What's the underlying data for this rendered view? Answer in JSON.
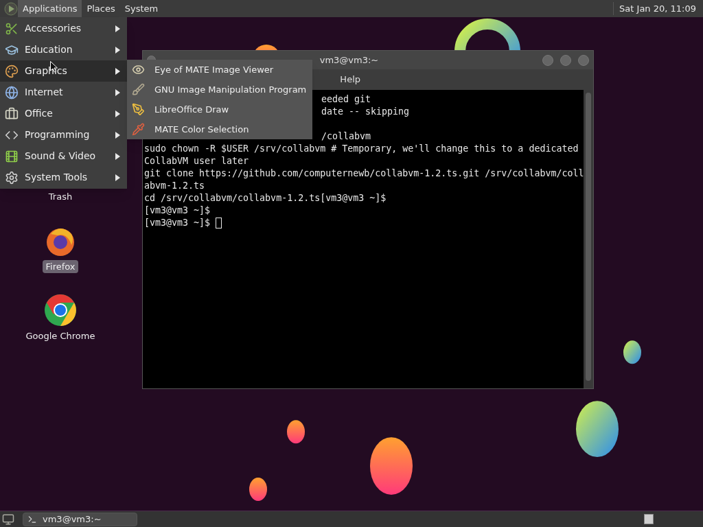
{
  "top_panel": {
    "menus": [
      {
        "label": "Applications",
        "selected": true
      },
      {
        "label": "Places",
        "selected": false
      },
      {
        "label": "System",
        "selected": false
      }
    ],
    "clock": "Sat Jan 20, 11:09"
  },
  "applications_menu": {
    "items": [
      {
        "label": "Accessories",
        "selected": false
      },
      {
        "label": "Education",
        "selected": false
      },
      {
        "label": "Graphics",
        "selected": true
      },
      {
        "label": "Internet",
        "selected": false
      },
      {
        "label": "Office",
        "selected": false
      },
      {
        "label": "Programming",
        "selected": false
      },
      {
        "label": "Sound & Video",
        "selected": false
      },
      {
        "label": "System Tools",
        "selected": false
      }
    ]
  },
  "graphics_submenu": {
    "items": [
      {
        "label": "Eye of MATE Image Viewer"
      },
      {
        "label": "GNU Image Manipulation Program"
      },
      {
        "label": "LibreOffice Draw"
      },
      {
        "label": "MATE Color Selection"
      }
    ]
  },
  "desktop_icons": [
    {
      "label": "Trash",
      "selected": false,
      "kind": "trash"
    },
    {
      "label": "Firefox",
      "selected": true,
      "kind": "firefox"
    },
    {
      "label": "Google Chrome",
      "selected": false,
      "kind": "chrome"
    }
  ],
  "terminal": {
    "title": "vm3@vm3:~",
    "menu": [
      "Help"
    ],
    "lines": [
      {
        "kind": "partial",
        "text": "eeded git"
      },
      {
        "kind": "partial",
        "text": "date -- skipping"
      },
      {
        "kind": "blank"
      },
      {
        "kind": "partial",
        "text": "/collabvm"
      },
      {
        "kind": "full",
        "text": "sudo chown -R $USER /srv/collabvm # Temporary, we'll change this to a dedicated"
      },
      {
        "kind": "full",
        "text": "CollabVM user later"
      },
      {
        "kind": "full",
        "text": "git clone https://github.com/computernewb/collabvm-1.2.ts.git /srv/collabvm/coll"
      },
      {
        "kind": "full",
        "text": "abvm-1.2.ts"
      },
      {
        "kind": "full",
        "text": "cd /srv/collabvm/collabvm-1.2.ts[vm3@vm3 ~]$"
      },
      {
        "kind": "full",
        "text": "[vm3@vm3 ~]$"
      },
      {
        "kind": "prompt",
        "text": "[vm3@vm3 ~]$"
      }
    ]
  },
  "bottom_panel": {
    "tasks": [
      {
        "label": "vm3@vm3:~",
        "selected": false
      }
    ]
  }
}
